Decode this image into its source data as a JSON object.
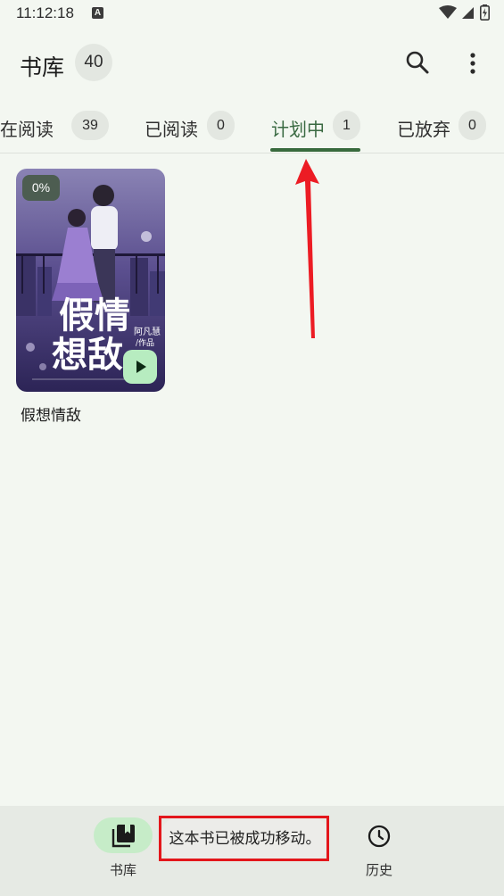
{
  "status_bar": {
    "time": "11:12:18",
    "notification_icon": "A"
  },
  "app_bar": {
    "title": "书库",
    "count": "40",
    "icons": [
      "search-icon",
      "more-vert-icon"
    ]
  },
  "tabs": [
    {
      "label": "正在阅读",
      "count": "39"
    },
    {
      "label": "已阅读",
      "count": "0"
    },
    {
      "label": "计划中",
      "count": "1",
      "active": true
    },
    {
      "label": "已放弃",
      "count": "0"
    }
  ],
  "books": [
    {
      "title": "假想情敌",
      "progress": "0%",
      "cover_title": "假情想敌",
      "cover_author": "阿凡慧",
      "cover_author_suffix": "/作品"
    }
  ],
  "bottom_nav": [
    {
      "label": "书库",
      "icon": "library-icon",
      "active": true
    },
    {
      "label": "历史",
      "icon": "history-icon",
      "active": false
    }
  ],
  "toast": {
    "message": "这本书已被成功移动。"
  },
  "colors": {
    "background": "#f3f7f1",
    "accent": "#386a3d",
    "annotation": "#e3161b"
  }
}
